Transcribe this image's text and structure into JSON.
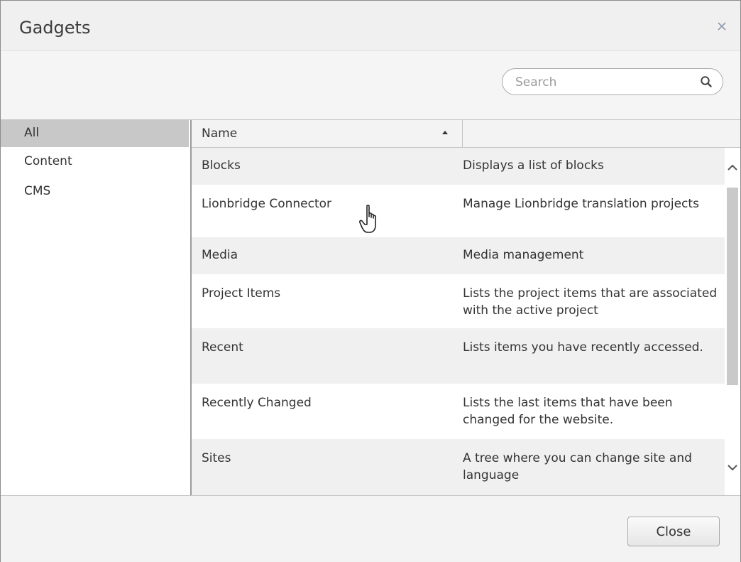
{
  "dialog": {
    "title": "Gadgets"
  },
  "search": {
    "placeholder": "Search"
  },
  "categories": [
    {
      "label": "All",
      "selected": true
    },
    {
      "label": "Content",
      "selected": false
    },
    {
      "label": "CMS",
      "selected": false
    }
  ],
  "table": {
    "columns": [
      "Name",
      ""
    ],
    "sort": "ascending",
    "rows": [
      {
        "name": "Blocks",
        "description": "Displays a list of blocks"
      },
      {
        "name": "Lionbridge Connector",
        "description": "Manage Lionbridge translation projects"
      },
      {
        "name": "Media",
        "description": "Media management"
      },
      {
        "name": "Project Items",
        "description": "Lists the project items that are associated with the active project"
      },
      {
        "name": "Recent",
        "description": "Lists items you have recently accessed."
      },
      {
        "name": "Recently Changed",
        "description": "Lists the last items that have been changed for the website."
      },
      {
        "name": "Sites",
        "description": "A tree where you can change site and language"
      }
    ]
  },
  "footer": {
    "close_label": "Close"
  },
  "icons": {
    "close": "close-icon",
    "search": "search-icon",
    "sort": "sort-ascending-icon",
    "cursor": "hand-pointer-icon"
  }
}
